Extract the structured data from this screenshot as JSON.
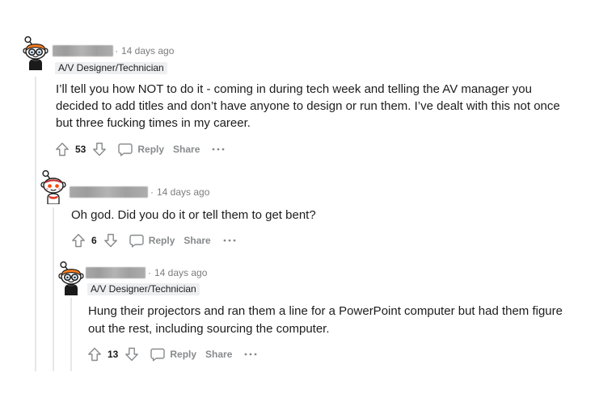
{
  "colors": {
    "text": "#1c1c1c",
    "meta": "#7c7c7c",
    "action": "#878a8c",
    "score": "#1a1a1b",
    "flair_bg": "#edeff1",
    "thread_line": "#e5e7e9"
  },
  "icons": {
    "upvote": "upvote-arrow-icon",
    "downvote": "downvote-arrow-icon",
    "reply": "comment-bubble-icon",
    "more": "more-options-icon"
  },
  "comment": {
    "separator": "·",
    "timestamp": "14 days ago",
    "flair": "A/V Designer/Technician",
    "body": "I’ll tell you how NOT to do it - coming in during tech week and telling the AV manager you decided to add titles and don’t have anyone to design or run them. I’ve dealt with this not once but three fucking times in my career.",
    "score": 53,
    "reply_label": "Reply",
    "share_label": "Share",
    "replies": [
      {
        "separator": "·",
        "timestamp": "14 days ago",
        "body": "Oh god. Did you do it or tell them to get bent?",
        "score": 6,
        "reply_label": "Reply",
        "share_label": "Share",
        "replies": [
          {
            "separator": "·",
            "timestamp": "14 days ago",
            "flair": "A/V Designer/Technician",
            "body": "Hung their projectors and ran them a line for a PowerPoint computer but had them figure out the rest, including sourcing the computer.",
            "score": 13,
            "reply_label": "Reply",
            "share_label": "Share"
          }
        ]
      }
    ]
  }
}
